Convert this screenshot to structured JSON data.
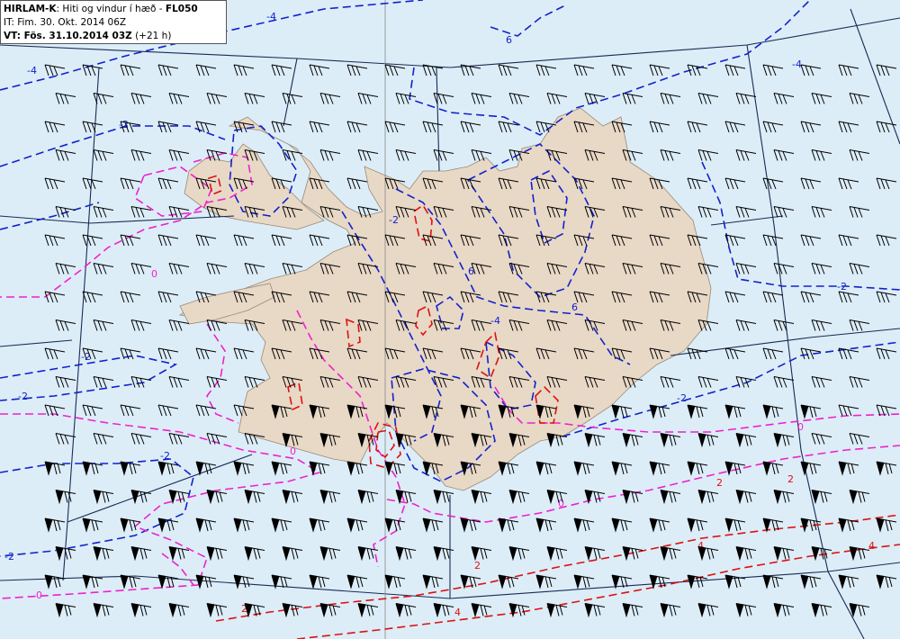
{
  "title": {
    "model": "HIRLAM-K",
    "desc": ": Hiti og vindur í hæð - ",
    "level": "FL050",
    "it_line": "IT: Fim. 30. Okt. 2014 06Z",
    "vt_prefix": "VT: ",
    "vt_bold": "Fös. 31.10.2014 03Z",
    "vt_suffix": " (+21 h)"
  },
  "contour_labels": [
    "-4",
    "-2",
    "0",
    "2",
    "4",
    "6"
  ],
  "colors": {
    "sea": "#dcedf8",
    "land": "#e8d8c6",
    "neg_contour": "#1122cc",
    "zero_contour": "#ee22cc",
    "pos_contour": "#dd1111",
    "grid": "#1a2a55",
    "barb": "#000000"
  },
  "map": {
    "projection_grid": "on",
    "wind_barbs": "on",
    "contour_style": "dashed"
  }
}
